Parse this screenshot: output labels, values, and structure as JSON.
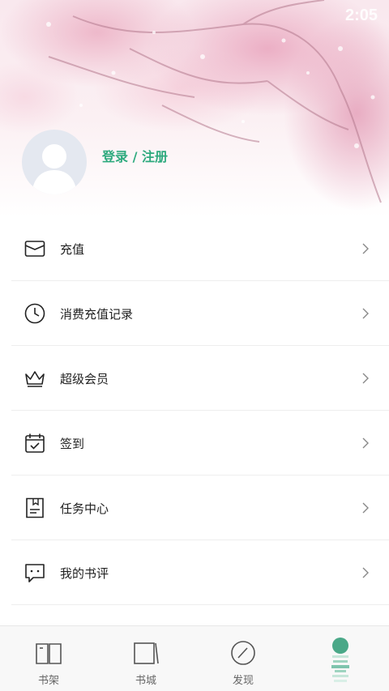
{
  "status_bar": {
    "time": "2:05"
  },
  "profile": {
    "login_label": "登录 / 注册"
  },
  "menu": {
    "items": [
      {
        "label": "充值",
        "icon": "wallet-icon"
      },
      {
        "label": "消费充值记录",
        "icon": "clock-icon"
      },
      {
        "label": "超级会员",
        "icon": "crown-icon"
      },
      {
        "label": "签到",
        "icon": "calendar-check-icon"
      },
      {
        "label": "任务中心",
        "icon": "task-doc-icon"
      },
      {
        "label": "我的书评",
        "icon": "comment-icon"
      }
    ]
  },
  "tabbar": {
    "tabs": [
      {
        "label": "书架",
        "icon": "open-book-icon"
      },
      {
        "label": "书城",
        "icon": "book-store-icon"
      },
      {
        "label": "发现",
        "icon": "compass-icon"
      },
      {
        "label": "",
        "icon": "profile-mascot-icon"
      }
    ]
  },
  "colors": {
    "accent": "#2eaa7e",
    "text": "#222222",
    "tab_text": "#666666",
    "tabbar_bg": "#f8f8f8"
  }
}
